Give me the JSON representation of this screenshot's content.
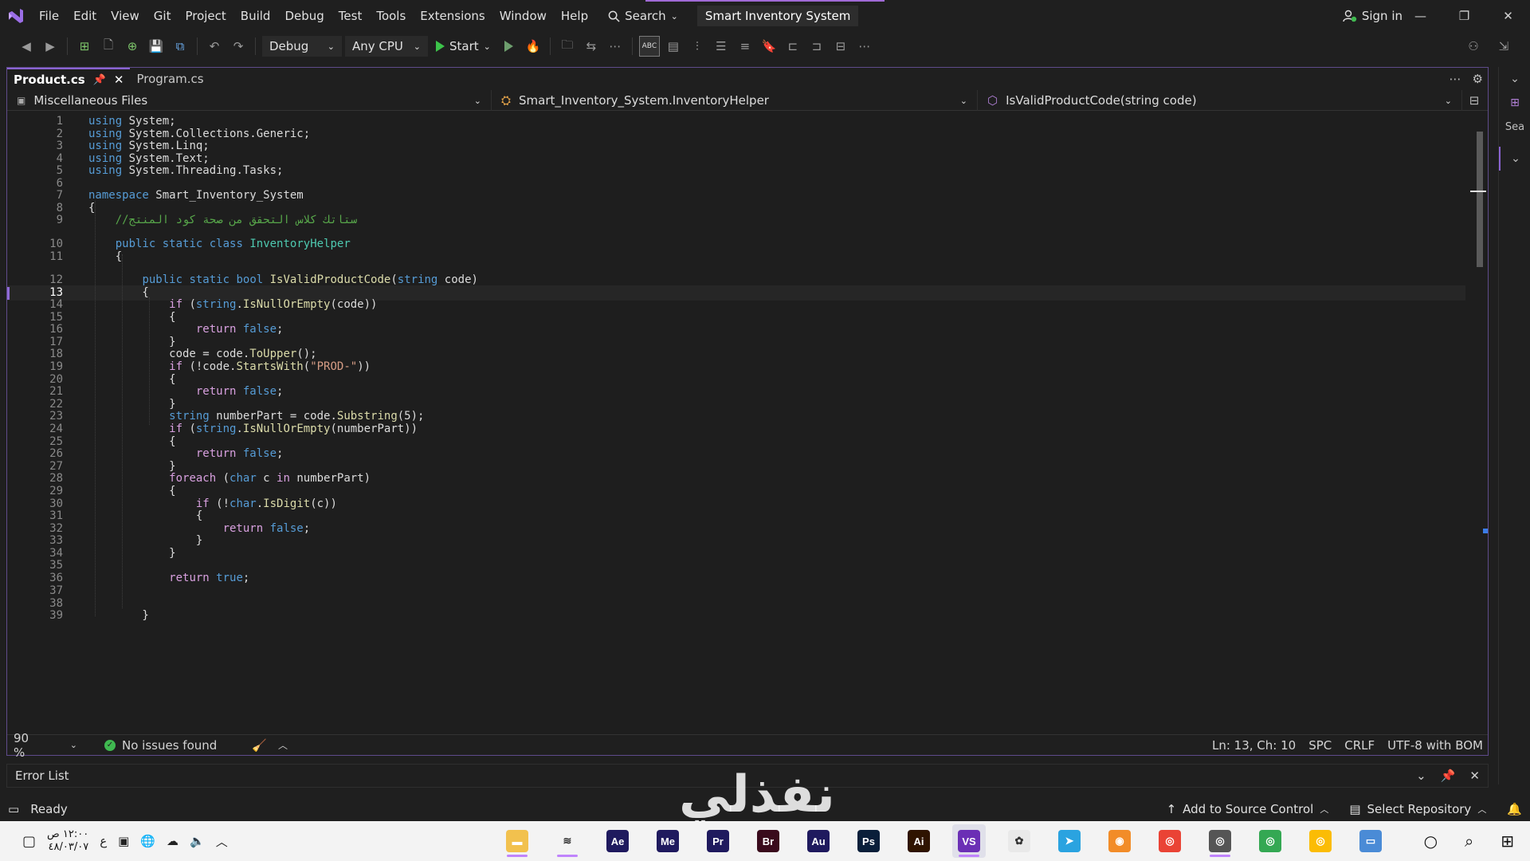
{
  "menu": {
    "items": [
      "File",
      "Edit",
      "View",
      "Git",
      "Project",
      "Build",
      "Debug",
      "Test",
      "Tools",
      "Extensions",
      "Window",
      "Help"
    ],
    "search_label": "Search",
    "solution_title": "Smart Inventory System",
    "signin_label": "Sign in"
  },
  "toolbar": {
    "config": "Debug",
    "platform": "Any CPU",
    "start_label": "Start"
  },
  "tabs": [
    {
      "label": "Product.cs",
      "active": true
    },
    {
      "label": "Program.cs",
      "active": false
    }
  ],
  "nav": {
    "project": "Miscellaneous Files",
    "type": "Smart_Inventory_System.InventoryHelper",
    "member": "IsValidProductCode(string code)"
  },
  "code": {
    "line_numbers": [
      "1",
      "2",
      "3",
      "4",
      "5",
      "6",
      "7",
      "8",
      "9",
      "10",
      "11",
      "12",
      "13",
      "14",
      "15",
      "16",
      "17",
      "18",
      "19",
      "20",
      "21",
      "22",
      "23",
      "24",
      "25",
      "26",
      "27",
      "28",
      "29",
      "30",
      "31",
      "32",
      "33",
      "34",
      "35",
      "36",
      "37",
      "38",
      "39"
    ],
    "current_line": 13,
    "comment_line": "//ستاتك كلاس التحقق من صحة كود المنتج",
    "namespace_name": "Smart_Inventory_System",
    "class_name": "InventoryHelper",
    "method_name": "IsValidProductCode",
    "prefix_literal": "\"PROD-\""
  },
  "editor_status": {
    "zoom": "90 %",
    "issues": "No issues found",
    "position": "Ln: 13, Ch: 10",
    "whitespace": "SPC",
    "line_endings": "CRLF",
    "encoding": "UTF-8 with BOM"
  },
  "error_list": {
    "title": "Error List"
  },
  "statusbar": {
    "ready": "Ready",
    "source_control": "Add to Source Control",
    "repository": "Select Repository"
  },
  "watermark": {
    "text": "نفذلي"
  },
  "taskbar": {
    "time": "١٢:٠٠ ص",
    "date": "٤٨/٠٣/٠٧",
    "lang": "ع",
    "apps": [
      {
        "name": "File Explorer",
        "icon": "folder-icon",
        "color": "#f2c14e",
        "glyph": "▬"
      },
      {
        "name": "Wave",
        "icon": "wave-icon",
        "color": "#f3f3f3",
        "glyph": "≋"
      },
      {
        "name": "After Effects",
        "icon": "ae-icon",
        "color": "#1f1a5e",
        "glyph": "Ae"
      },
      {
        "name": "Media Encoder",
        "icon": "me-icon",
        "color": "#1f1a5e",
        "glyph": "Me"
      },
      {
        "name": "Premiere Rush",
        "icon": "pr-icon",
        "color": "#1f1a5e",
        "glyph": "Pr"
      },
      {
        "name": "Bridge",
        "icon": "br-icon",
        "color": "#3a0b1c",
        "glyph": "Br"
      },
      {
        "name": "Audition",
        "icon": "au-icon",
        "color": "#1f1a5e",
        "glyph": "Au"
      },
      {
        "name": "Photoshop",
        "icon": "ps-icon",
        "color": "#0a1f3a",
        "glyph": "Ps"
      },
      {
        "name": "Illustrator",
        "icon": "ai-icon",
        "color": "#2f1400",
        "glyph": "Ai"
      },
      {
        "name": "Visual Studio",
        "icon": "visual-studio-icon",
        "color": "#6b2fb5",
        "glyph": "VS"
      },
      {
        "name": "Settings",
        "icon": "colorful-gear-icon",
        "color": "#e9e9e9",
        "glyph": "✿"
      },
      {
        "name": "Telegram",
        "icon": "telegram-icon",
        "color": "#2aa3e0",
        "glyph": "➤"
      },
      {
        "name": "Firefox",
        "icon": "firefox-icon",
        "color": "#f28c28",
        "glyph": "◉"
      },
      {
        "name": "Chrome",
        "icon": "chrome-icon",
        "color": "#ea4335",
        "glyph": "◎"
      },
      {
        "name": "Chrome Profile",
        "icon": "chrome-profile-icon",
        "color": "#555555",
        "glyph": "◎"
      },
      {
        "name": "Chrome 2",
        "icon": "chrome-icon",
        "color": "#34a853",
        "glyph": "◎"
      },
      {
        "name": "Chrome 3",
        "icon": "chrome-icon",
        "color": "#fbbc05",
        "glyph": "◎"
      },
      {
        "name": "Desktop",
        "icon": "desktop-icon",
        "color": "#4a8bd6",
        "glyph": "▭"
      }
    ]
  },
  "colors": {
    "accent": "#8a63d2",
    "editor_bg": "#1e1e1e",
    "chrome_bg": "#1f1f1f"
  }
}
